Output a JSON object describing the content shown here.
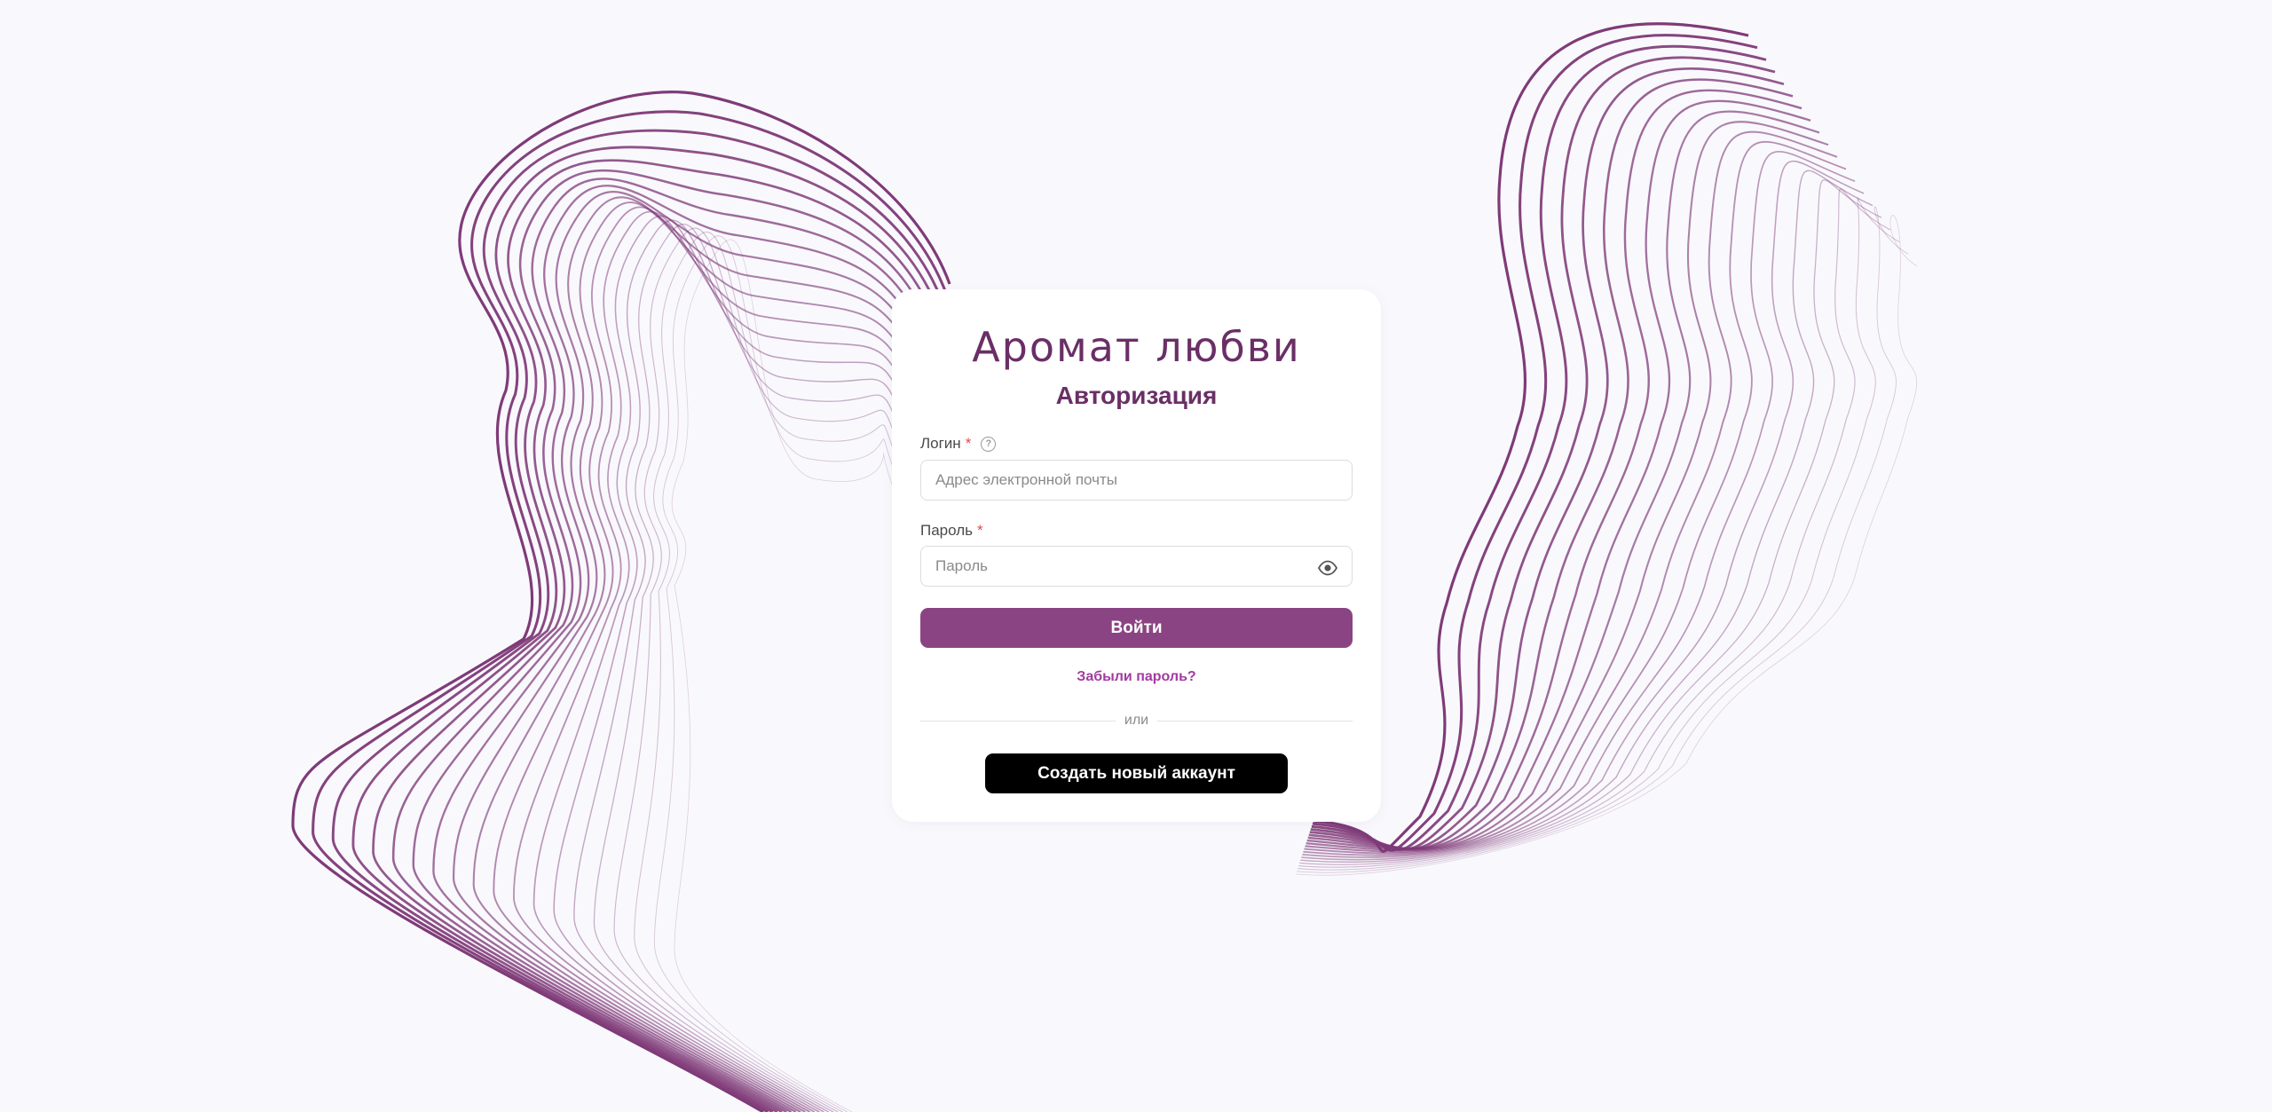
{
  "brand": {
    "logo_text": "Аромат любви",
    "accent_color": "#6a2f66",
    "button_color": "#8b4483"
  },
  "form": {
    "title": "Авторизация",
    "login": {
      "label": "Логин",
      "required_mark": "*",
      "help_icon": "question-circle-icon",
      "placeholder": "Адрес электронной почты",
      "value": ""
    },
    "password": {
      "label": "Пароль",
      "required_mark": "*",
      "placeholder": "Пароль",
      "value": "",
      "toggle_icon": "eye-icon"
    },
    "submit_label": "Войти",
    "forgot_label": "Забыли пароль?",
    "divider_text": "или",
    "create_account_label": "Создать новый аккаунт"
  }
}
